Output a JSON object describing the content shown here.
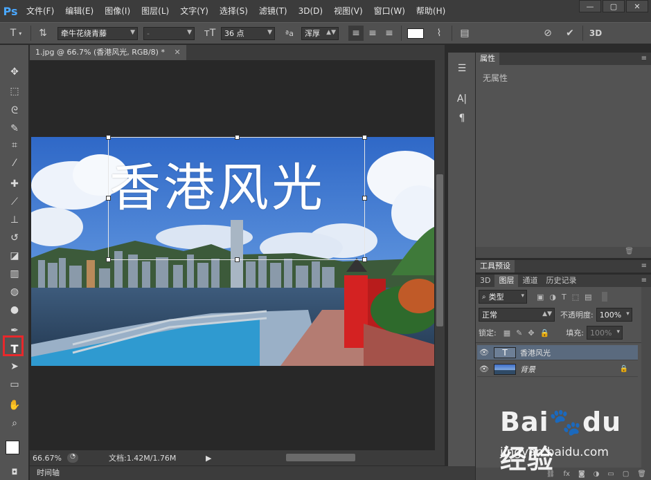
{
  "app": {
    "logo": "Ps"
  },
  "menu": [
    "文件(F)",
    "编辑(E)",
    "图像(I)",
    "图层(L)",
    "文字(Y)",
    "选择(S)",
    "滤镜(T)",
    "3D(D)",
    "视图(V)",
    "窗口(W)",
    "帮助(H)"
  ],
  "window_controls": [
    "—",
    "▢",
    "✕"
  ],
  "options": {
    "font_family": "牵牛花绕青藤",
    "font_style": "-",
    "font_size": "36 点",
    "aa_label": "ªa",
    "antialias": "浑厚",
    "mode_3d": "3D"
  },
  "document": {
    "tab_title": "1.jpg @ 66.7% (香港风光, RGB/8) *",
    "text_layer_content": "香港风光"
  },
  "status": {
    "zoom": "66.67%",
    "doc_info": "文档:1.42M/1.76M",
    "timeline_label": "时间轴"
  },
  "properties": {
    "tab": "属性",
    "empty_text": "无属性"
  },
  "tool_presets": {
    "tab": "工具预设"
  },
  "layers_panel": {
    "tabs": [
      "3D",
      "图层",
      "通道",
      "历史记录"
    ],
    "filter_kind": "类型",
    "blend_mode": "正常",
    "opacity_label": "不透明度:",
    "opacity_value": "100%",
    "lock_label": "锁定:",
    "fill_label": "填充:",
    "fill_value": "100%",
    "layers": [
      {
        "name": "香港风光",
        "kind": "text",
        "active": true
      },
      {
        "name": "背景",
        "kind": "image",
        "active": false,
        "locked": true
      }
    ]
  },
  "watermark": {
    "logo": "Bai🐾du经验",
    "url": "jingyan.baidu.com"
  },
  "icons": {
    "tools": [
      "move-icon",
      "marquee-icon",
      "lasso-icon",
      "quick-select-icon",
      "crop-icon",
      "eyedropper-icon",
      "healing-icon",
      "brush-icon",
      "stamp-icon",
      "history-brush-icon",
      "eraser-icon",
      "gradient-icon",
      "blur-icon",
      "dodge-icon",
      "pen-icon",
      "type-icon",
      "path-select-icon",
      "shape-icon",
      "hand-icon",
      "zoom-icon"
    ]
  },
  "colors": {
    "highlight": "#e8282b",
    "accent": "#4aa8ff"
  }
}
